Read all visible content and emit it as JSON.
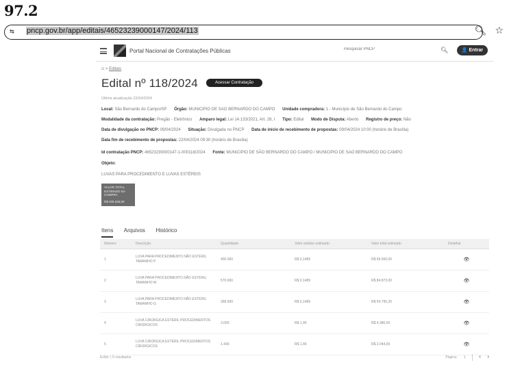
{
  "scan_label": "97.2",
  "browser": {
    "url": "pncp.gov.br/app/editais/46523239000147/2024/113",
    "site_icon": "⇆",
    "zoom_icon": "zoom-icon",
    "star_icon": "star-icon"
  },
  "nav": {
    "portal_title": "Portal Nacional de Contratações Públicas",
    "search_placeholder": "Pesquisar PNCP",
    "enter_label": "Entrar"
  },
  "breadcrumb": {
    "home": "⌂",
    "current": "Editais"
  },
  "page": {
    "title": "Edital nº 118/2024",
    "action_button": "Acessar Contratação",
    "last_update": "Última atualização 22/04/2024"
  },
  "info": {
    "local_label": "Local:",
    "local_value": "São Bernardo do Campo/SP",
    "orgao_label": "Órgão:",
    "orgao_value": "MUNICIPIO DE SAO BERNARDO DO CAMPO",
    "unidade_label": "Unidade compradora:",
    "unidade_value": "1 - Município de São Bernardo do Campo",
    "modalidade_label": "Modalidade da contratação:",
    "modalidade_value": "Pregão - Eletrônico",
    "amparo_label": "Amparo legal:",
    "amparo_value": "Lei 14.133/2021, Art. 28, I",
    "tipo_label": "Tipo:",
    "tipo_value": "Edital",
    "disputa_label": "Modo de Disputa:",
    "disputa_value": "Aberto",
    "registro_label": "Registro de preço:",
    "registro_value": "Não",
    "divulgacao_label": "Data de divulgação no PNCP:",
    "divulgacao_value": "09/04/2024",
    "situacao_label": "Situação:",
    "situacao_value": "Divulgada no PNCP",
    "inicio_label": "Data de início de recebimento de propostas:",
    "inicio_value": "09/04/2024 10:00 (horário de Brasília)",
    "fim_label": "Data fim de recebimento de propostas:",
    "fim_value": "22/04/2024 09:30 (horário de Brasília)",
    "id_label": "Id contratação PNCP:",
    "id_value": "46523239000147-1-000118/2024",
    "fonte_label": "Fonte:",
    "fonte_value": "MUNICIPIO DE SÃO BERNARDO DO CAMPO / MUNICIPIO DE SAO BERNARDO DO CAMPO",
    "objeto_label": "Objeto:",
    "objeto_value": "LUVAS PARA PROCEDIMENTO E LUVAS ESTÉREIS"
  },
  "value_card": {
    "label": "VALOR TOTAL ESTIMADO DA COMPRA",
    "value": "R$ 205.636,00"
  },
  "tabs": [
    {
      "label": "Itens"
    },
    {
      "label": "Arquivos"
    },
    {
      "label": "Histórico"
    }
  ],
  "table": {
    "headers": [
      "Número",
      "Descrição",
      "Quantidade",
      "Valor unitário estimado",
      "Valor total estimado",
      "Detalhar"
    ],
    "rows": [
      {
        "num": "1",
        "desc": "LUVA PARA PROCEDIMENTO NÃO ESTÉRIL TAMANHO P",
        "qty": "400.000",
        "unit": "R$ 0,1489",
        "total": "R$ 59.560,00"
      },
      {
        "num": "2",
        "desc": "LUVA PARA PROCEDIMENTO NÃO ESTÉRIL TAMANHO M",
        "qty": "570.000",
        "unit": "R$ 0,1489",
        "total": "R$ 84.873,00"
      },
      {
        "num": "3",
        "desc": "LUVA PARA PROCEDIMENTO NÃO ESTÉRIL TAMANHO G",
        "qty": "368.000",
        "unit": "R$ 0,1489",
        "total": "R$ 54.795,20"
      },
      {
        "num": "4",
        "desc": "LUVA CIRÚRGICA ESTÉRIL PROCEDIMENTOS CIRÚRGICOS",
        "qty": "3.000",
        "unit": "R$ 1,46",
        "total": "R$ 4.380,00"
      },
      {
        "num": "5",
        "desc": "LUVA CIRÚRGICA ESTÉRIL PROCEDIMENTOS CIRÚRGICOS",
        "qty": "1.400",
        "unit": "R$ 1,46",
        "total": "R$ 2.044,00"
      }
    ]
  },
  "pager": {
    "show_label": "Exibir:",
    "count_label": "5 resultados",
    "page_label": "Página:",
    "page_value": "1",
    "prev": "‹",
    "next": "›"
  }
}
